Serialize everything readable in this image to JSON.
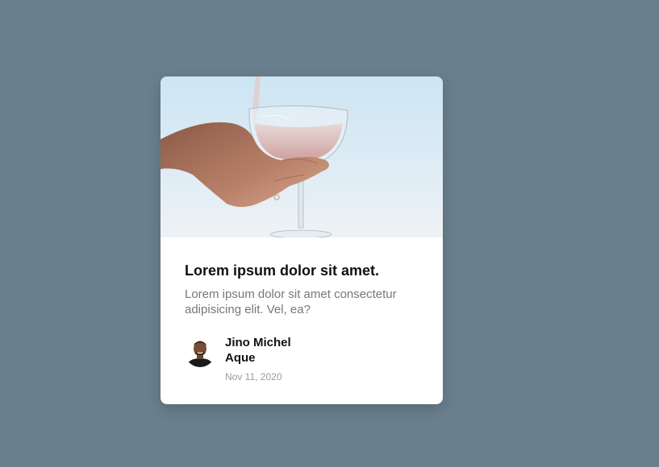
{
  "card": {
    "image_alt": "hand-pouring-water-into-glass-photo",
    "title": "Lorem ipsum dolor sit amet.",
    "text": "Lorem ipsum dolor sit amet consectetur adipisicing elit. Vel, ea?",
    "author": {
      "name": "Jino Michel Aque",
      "date": "Nov 11, 2020"
    }
  },
  "colors": {
    "background": "#6a7f8d",
    "card": "#ffffff",
    "title": "#111111",
    "text": "#777777",
    "date": "#9a9a9a"
  }
}
